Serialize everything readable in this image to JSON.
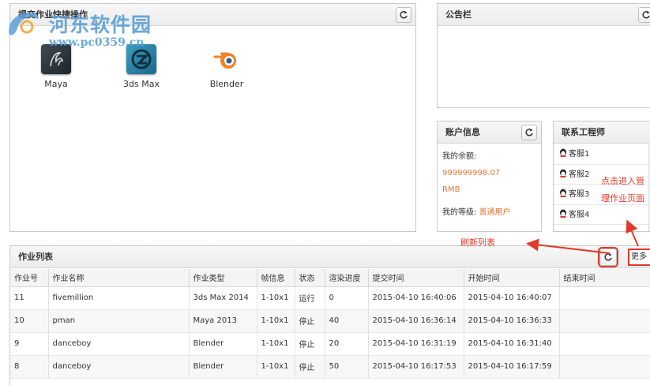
{
  "quick_submit": {
    "title": "提交作业快捷操作",
    "apps": [
      {
        "name": "maya-icon",
        "label": "Maya"
      },
      {
        "name": "3ds-max-icon",
        "label": "3ds Max"
      },
      {
        "name": "blender-icon",
        "label": "Blender"
      }
    ]
  },
  "bulletin": {
    "title": "公告栏"
  },
  "account": {
    "title": "账户信息",
    "balance_label": "我的余额:",
    "balance_value": "999999998.07",
    "balance_unit": "RMB",
    "level_label": "我的等级:",
    "level_value": "普通用户"
  },
  "engineer": {
    "title": "联系工程师",
    "items": [
      "客服1",
      "客服2",
      "客服3",
      "客服4"
    ]
  },
  "job_list": {
    "title": "作业列表",
    "more_label": "更多",
    "columns": [
      "作业号",
      "作业名称",
      "作业类型",
      "帧信息",
      "状态",
      "渲染进度",
      "提交时间",
      "开始时间",
      "结束时间"
    ],
    "rows": [
      [
        "11",
        "fivemillion",
        "3ds Max 2014",
        "1-10x1",
        "运行",
        "0",
        "2015-04-10 16:40:06",
        "2015-04-10 16:40:07",
        ""
      ],
      [
        "10",
        "pman",
        "Maya 2013",
        "1-10x1",
        "停止",
        "40",
        "2015-04-10 16:36:14",
        "2015-04-10 16:36:33",
        ""
      ],
      [
        "9",
        "danceboy",
        "Blender",
        "1-10x1",
        "停止",
        "20",
        "2015-04-10 16:31:19",
        "2015-04-10 16:31:40",
        ""
      ],
      [
        "8",
        "danceboy",
        "Blender",
        "1-10x1",
        "停止",
        "50",
        "2015-04-10 16:17:53",
        "2015-04-10 16:17:59",
        ""
      ]
    ]
  },
  "annotations": {
    "refresh_note": "刷新列表",
    "manage_note_line1": "点击进入管",
    "manage_note_line2": "理作业页面"
  },
  "watermark": {
    "title": "河东软件园",
    "url": "www.pc0359.cn"
  },
  "colors": {
    "accent_orange": "#e8763a",
    "annotation_red": "#e03a2a",
    "watermark_blue": "#5a9fd6"
  }
}
